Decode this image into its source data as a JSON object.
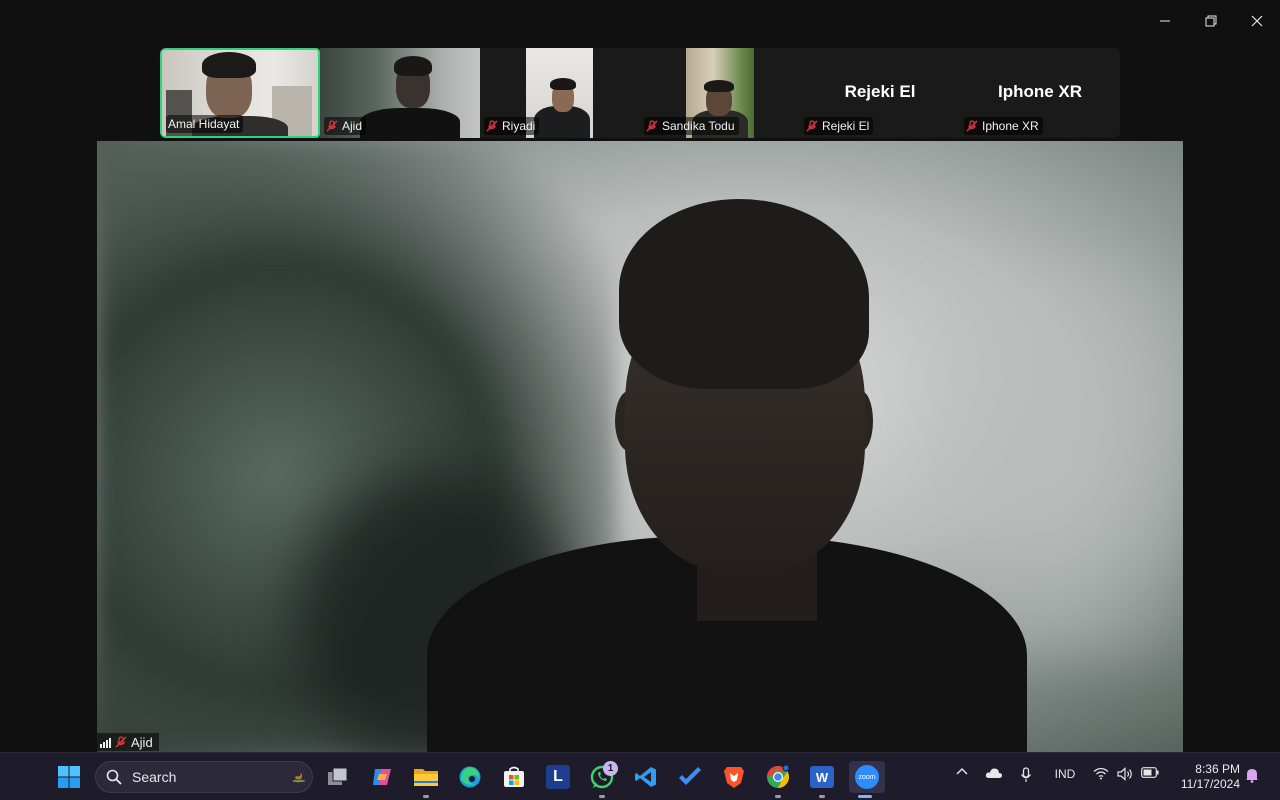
{
  "window": {
    "controls": [
      "minimize",
      "restore",
      "close"
    ]
  },
  "gallery": {
    "participants": [
      {
        "name": "Amal Hidayat",
        "muted": false,
        "video": true,
        "active_speaker": true
      },
      {
        "name": "Ajid",
        "muted": true,
        "video": true
      },
      {
        "name": "Riyadi",
        "muted": true,
        "video": true
      },
      {
        "name": "Sandika Todu",
        "muted": true,
        "video": true
      },
      {
        "name": "Rejeki El",
        "display_name": "Rejeki El",
        "muted": true,
        "video": false
      },
      {
        "name": "Iphone XR",
        "display_name": "Iphone XR",
        "muted": true,
        "video": false
      }
    ]
  },
  "main_video": {
    "speaker_name": "Ajid",
    "muted": true
  },
  "taskbar": {
    "search_label": "Search",
    "apps": [
      {
        "icon": "windows-start-icon"
      },
      {
        "icon": "task-view-icon"
      },
      {
        "icon": "copilot-icon"
      },
      {
        "icon": "file-explorer-icon"
      },
      {
        "icon": "edge-icon"
      },
      {
        "icon": "microsoft-store-icon"
      },
      {
        "icon": "l-app-icon",
        "label": "L"
      },
      {
        "icon": "whatsapp-icon",
        "badge": "1"
      },
      {
        "icon": "vscode-icon"
      },
      {
        "icon": "todo-icon"
      },
      {
        "icon": "brave-icon"
      },
      {
        "icon": "chrome-icon"
      },
      {
        "icon": "word-icon",
        "label": "W"
      },
      {
        "icon": "zoom-icon",
        "label": "zoom"
      }
    ],
    "tray": {
      "language": "IND",
      "time": "8:36 PM",
      "date": "11/17/2024"
    }
  },
  "colors": {
    "active_border": "#2fd37a",
    "taskbar_bg": "#1e1b2b",
    "muted_red": "#e0363b"
  }
}
